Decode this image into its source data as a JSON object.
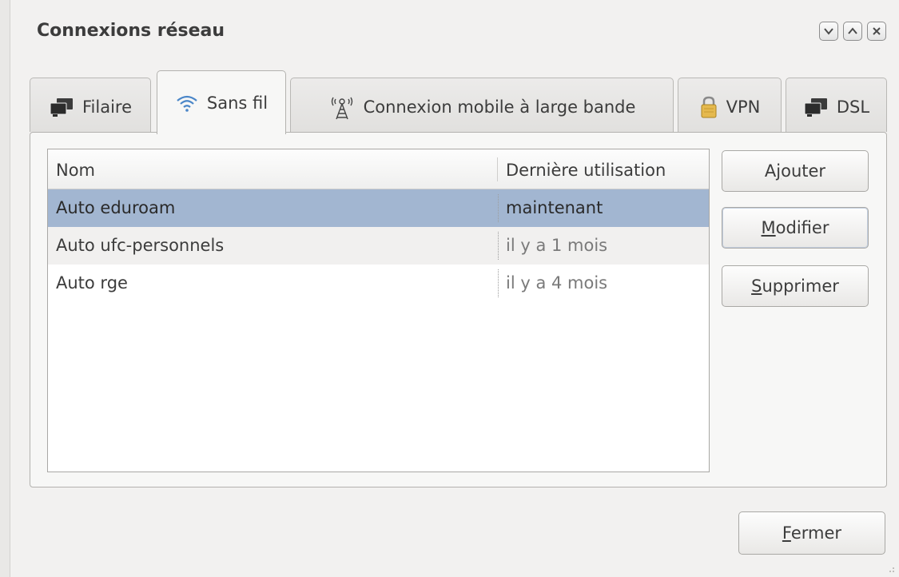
{
  "window": {
    "title": "Connexions réseau",
    "controls": [
      "minimize",
      "maximize",
      "close"
    ]
  },
  "tabs": [
    {
      "label": "Filaire",
      "icon": "wired-network-icon",
      "active": false
    },
    {
      "label": "Sans fil",
      "icon": "wifi-icon",
      "active": true
    },
    {
      "label": "Connexion mobile à large bande",
      "icon": "antenna-icon",
      "active": false
    },
    {
      "label": "VPN",
      "icon": "padlock-icon",
      "active": false
    },
    {
      "label": "DSL",
      "icon": "wired-network-icon",
      "active": false
    }
  ],
  "list": {
    "columns": [
      "Nom",
      "Dernière utilisation"
    ],
    "rows": [
      {
        "name": "Auto eduroam",
        "last_used": "maintenant",
        "selected": true
      },
      {
        "name": "Auto ufc-personnels",
        "last_used": "il y a 1 mois",
        "selected": false
      },
      {
        "name": "Auto rge",
        "last_used": "il y a 4 mois",
        "selected": false
      }
    ]
  },
  "buttons": {
    "add": {
      "pre": "A",
      "mn": "j",
      "post": "outer"
    },
    "edit": {
      "pre": "",
      "mn": "M",
      "post": "odifier"
    },
    "delete": {
      "pre": "",
      "mn": "S",
      "post": "upprimer"
    },
    "close": {
      "pre": "",
      "mn": "F",
      "post": "ermer"
    }
  },
  "colors": {
    "selection": "#a2b6d1",
    "wifi_icon": "#4a86c8",
    "padlock": "#e5b94e"
  }
}
